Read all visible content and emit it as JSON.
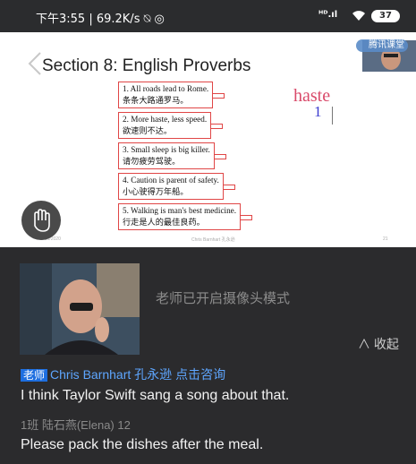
{
  "status_bar": {
    "time_speed": "下午3:55 | 69.2K/s ⍉ ◎",
    "signal": "ᴴᴰ.ıl",
    "battery": "37"
  },
  "slide": {
    "title": "Section 8: English Proverbs",
    "proverbs": [
      {
        "en": "1. All roads lead to Rome.",
        "zh": "条条大路通罗马。"
      },
      {
        "en": "2. More haste, less speed.",
        "zh": "欲速则不达。"
      },
      {
        "en": "3. Small sleep is big killer.",
        "zh": "请勿疲劳驾驶。"
      },
      {
        "en": "4. Caution is parent of safety.",
        "zh": "小心驶得万年船。"
      },
      {
        "en": "5. Walking is man's best medicine.",
        "zh": "行走是人的最佳良药。"
      }
    ],
    "annotation_word": "haste",
    "annotation_count": "1",
    "footer_left": "6/11/2020",
    "footer_center": "Chris Barnhart 孔永逊",
    "footer_right": "21",
    "teacher_tag": "腾讯课堂"
  },
  "camera": {
    "message": "老师已开启摄像头模式",
    "collapse_label": "∧ 收起"
  },
  "chat": {
    "messages": [
      {
        "role": "老师",
        "name": "Chris Barnhart 孔永逊",
        "action": "点击咨询",
        "text": "I think Taylor Swift sang a song about that."
      },
      {
        "meta": "1班 陆石燕(Elena)  12",
        "text": "Please pack the dishes after the meal."
      }
    ]
  },
  "icons": [
    "back-chevron-icon",
    "wifi-icon",
    "battery-icon",
    "raise-hand-icon",
    "signal-icon"
  ]
}
